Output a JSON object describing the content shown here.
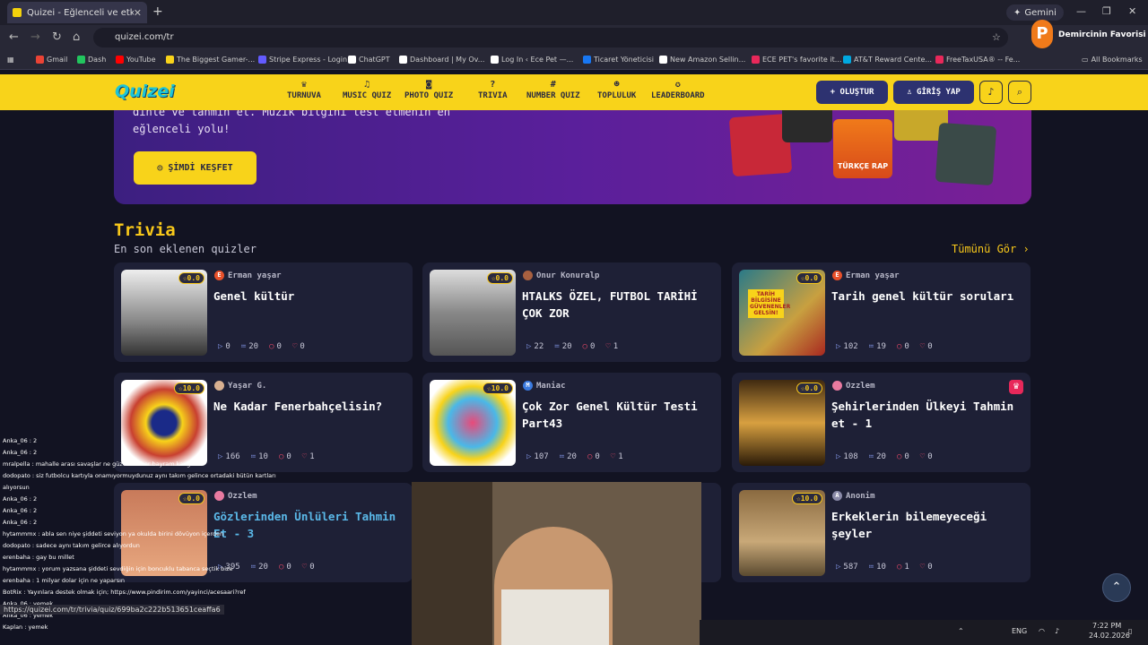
{
  "browser": {
    "tab_title": "Quizei - Eğlenceli ve etkileşimli",
    "url": "quizei.com/tr",
    "gemini_label": "Gemini",
    "profile_name": "Demircinin Favorisi",
    "all_bookmarks": "All Bookmarks",
    "bookmarks": [
      {
        "label": "Gmail",
        "color": "#ea4335"
      },
      {
        "label": "Dash",
        "color": "#22c55e"
      },
      {
        "label": "YouTube",
        "color": "#ff0000"
      },
      {
        "label": "The Biggest Gamer-...",
        "color": "#f8d31a"
      },
      {
        "label": "Stripe Express - Login",
        "color": "#635bff"
      },
      {
        "label": "ChatGPT",
        "color": "#ffffff"
      },
      {
        "label": "Dashboard | My Ov...",
        "color": "#ffffff"
      },
      {
        "label": "Log In ‹ Ece Pet —...",
        "color": "#ffffff"
      },
      {
        "label": "Ticaret Yöneticisi",
        "color": "#1877f2"
      },
      {
        "label": "New Amazon Sellin...",
        "color": "#ffffff"
      },
      {
        "label": "ECE PET's favorite it...",
        "color": "#e8285a"
      },
      {
        "label": "AT&T Reward Cente...",
        "color": "#00a8e0"
      },
      {
        "label": "FreeTaxUSA® -- Fe...",
        "color": "#e8285a"
      }
    ]
  },
  "site": {
    "logo": "Quizei",
    "nav": [
      {
        "label": "TURNUVA",
        "icon": "trophy-icon",
        "glyph": "♛"
      },
      {
        "label": "MUSIC QUIZ",
        "icon": "music-icon",
        "glyph": "♫"
      },
      {
        "label": "PHOTO QUIZ",
        "icon": "camera-icon",
        "glyph": "◙"
      },
      {
        "label": "TRIVIA",
        "icon": "question-icon",
        "glyph": "?"
      },
      {
        "label": "NUMBER QUIZ",
        "icon": "hash-icon",
        "glyph": "#"
      },
      {
        "label": "TOPLULUK",
        "icon": "community-icon",
        "glyph": "☻"
      },
      {
        "label": "LEADERBOARD",
        "icon": "medal-icon",
        "glyph": "✪"
      }
    ],
    "create_label": "+ OLUŞTUR",
    "login_label": "GİRİŞ YAP"
  },
  "hero": {
    "text": "dinle ve tahmin et. Müzik bilgini test etmenin en eğlenceli yolu!",
    "button_label": "ŞİMDİ KEŞFET",
    "album_label": "TÜRKÇE RAP"
  },
  "section": {
    "title": "Trivia",
    "subtitle": "En son eklenen quizler",
    "see_all": "Tümünü Gör ›"
  },
  "cards": [
    {
      "author": "Erman yaşar",
      "avatar_color": "#e8502a",
      "avatar_letter": "E",
      "rating": "☆0.0",
      "title": "Genel kültür",
      "plays": "0",
      "questions": "20",
      "comments": "0",
      "likes": "0",
      "thumb": "einstein"
    },
    {
      "author": "Onur Konuralp",
      "avatar_color": "#a86040",
      "avatar_letter": "",
      "rating": "☆0.0",
      "title": "HTALKS ÖZEL, FUTBOL TARİHİ ÇOK ZOR",
      "plays": "22",
      "questions": "20",
      "comments": "0",
      "likes": "1",
      "thumb": "football"
    },
    {
      "author": "Erman yaşar",
      "avatar_color": "#e8502a",
      "avatar_letter": "E",
      "rating": "☆0.0",
      "title": "Tarih genel kültür soruları",
      "plays": "102",
      "questions": "19",
      "comments": "0",
      "likes": "0",
      "thumb": "history",
      "thumb_text": "TARİH BİLGİSİNE GÜVENENLER GELSİN!"
    },
    {
      "author": "Yaşar G.",
      "avatar_color": "#d8b090",
      "avatar_letter": "",
      "rating": "☆10.0",
      "title": "Ne Kadar Fenerbahçelisin?",
      "plays": "166",
      "questions": "10",
      "comments": "0",
      "likes": "1",
      "thumb": "fenerbahce"
    },
    {
      "author": "Maniac",
      "avatar_color": "#3a7ae0",
      "avatar_letter": "M",
      "rating": "☆10.0",
      "title": "Çok Zor Genel Kültür Testi Part43",
      "plays": "107",
      "questions": "20",
      "comments": "0",
      "likes": "1",
      "thumb": "brain"
    },
    {
      "author": "Ozzlem",
      "avatar_color": "#e87aa0",
      "avatar_letter": "",
      "rating": "☆0.0",
      "title": "Şehirlerinden Ülkeyi Tahmin et - 1",
      "plays": "108",
      "questions": "20",
      "comments": "0",
      "likes": "0",
      "thumb": "city",
      "crown": true
    },
    {
      "author": "Ozzlem",
      "avatar_color": "#e87aa0",
      "avatar_letter": "",
      "rating": "☆0.0",
      "title": "Gözlerinden Ünlüleri Tahmin Et - 3",
      "plays": "395",
      "questions": "20",
      "comments": "0",
      "likes": "0",
      "thumb": "eyes",
      "title_color": "#5ab8e8"
    },
    {
      "author": "",
      "avatar_color": "#3a3a50",
      "avatar_letter": "",
      "rating": "",
      "title": "",
      "plays": "",
      "questions": "",
      "comments": "",
      "likes": "",
      "thumb": "hidden"
    },
    {
      "author": "Anonim",
      "avatar_color": "#8a8aa8",
      "avatar_letter": "A",
      "rating": "☆10.0",
      "title": "Erkeklerin bilemeyeceği şeyler",
      "plays": "587",
      "questions": "10",
      "comments": "1",
      "likes": "0",
      "thumb": "monkeys"
    }
  ],
  "chat": [
    "Anka_06 : 2",
    "Anka_06 : 2",
    "mralpella : mahalle arası savaşlar ne güzeldi 2 her bayram kavga",
    "dodopato : siz futbolcu kartıyla onamıyormuydunuz aynı takım gelince ortadaki bütün kartları",
    "alıyorsun",
    "Anka_06 : 2",
    "Anka_06 : 2",
    "Anka_06 : 2",
    "hytammmx : abla sen niye şiddeti seviyon ya okulda birini dövüyon içerden",
    "dodopato : sadece aynı takım gelirce alıyordun",
    "erenbaha : gay bu millet",
    "hytammmx : yorum yazsana şiddeti sevdiğin için boncuklu tabanca seçtik bize",
    "erenbaha : 1 milyar dolar için ne yaparsın",
    "BotRix : Yayınlara destek olmak için; https://www.pindirim.com/yayinci/acesaari?ref",
    "Anka_06 : yemek",
    "Anka_06 : yemek",
    "Kaplan : yemek"
  ],
  "status_url": "https://quizei.com/tr/trivia/quiz/699ba2c222b513651ceaffa6",
  "taskbar": {
    "lang": "ENG",
    "time": "7:22 PM",
    "date": "24.02.2026"
  }
}
